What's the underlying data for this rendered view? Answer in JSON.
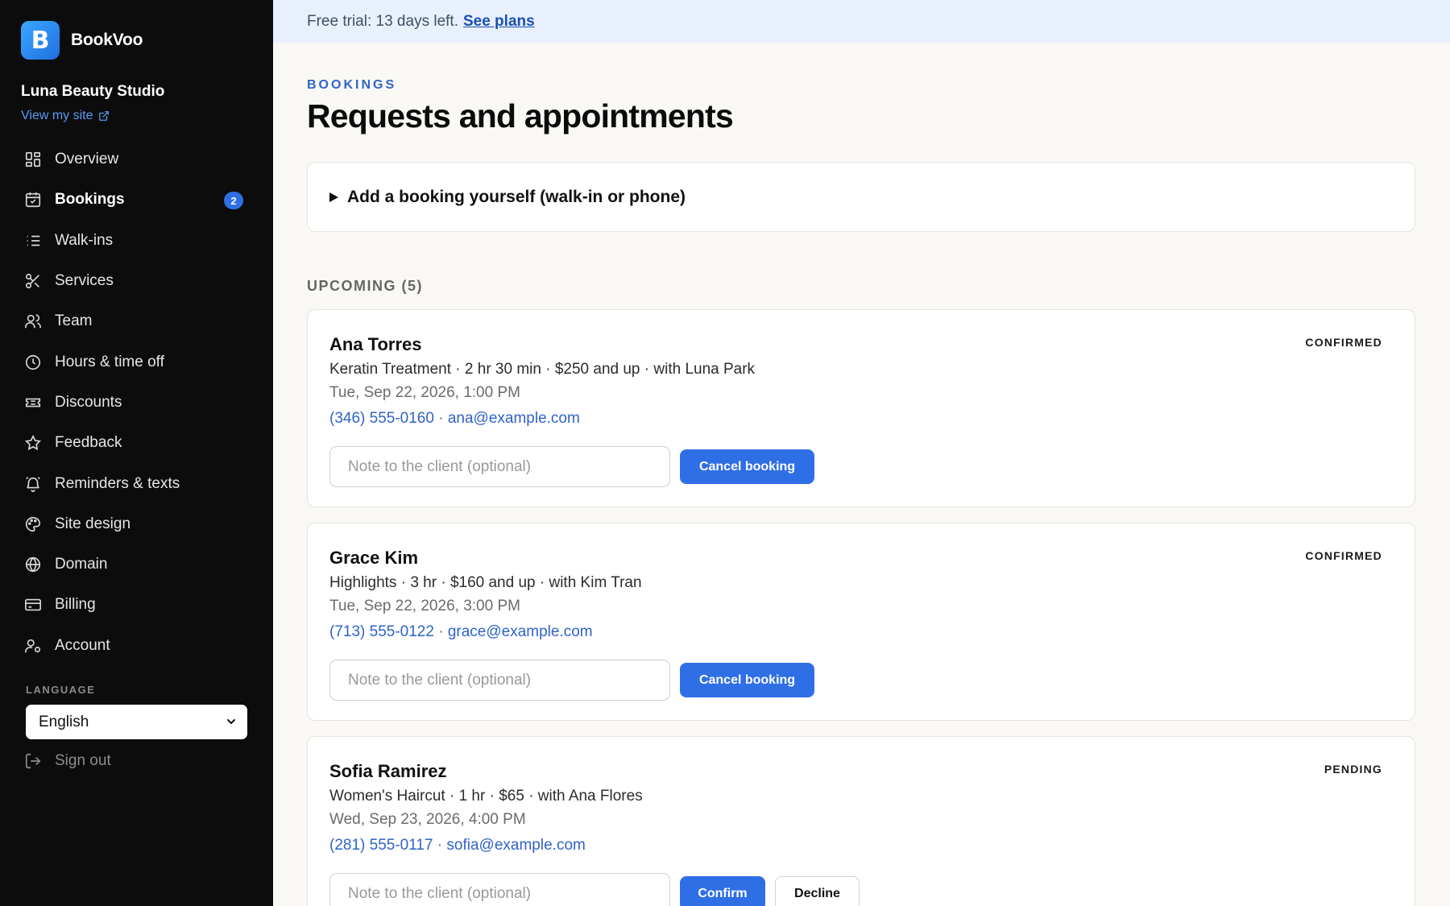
{
  "app": {
    "brand_name": "BookVoo",
    "logo_letter": "B",
    "studio_name": "Luna Beauty Studio",
    "view_site_label": "View my site"
  },
  "sidebar": {
    "items": [
      {
        "label": "Overview",
        "icon": "grid-icon"
      },
      {
        "label": "Bookings",
        "icon": "calendar-icon",
        "badge": "2",
        "active": true
      },
      {
        "label": "Walk-ins",
        "icon": "list-icon"
      },
      {
        "label": "Services",
        "icon": "scissors-icon"
      },
      {
        "label": "Team",
        "icon": "users-icon"
      },
      {
        "label": "Hours & time off",
        "icon": "clock-icon"
      },
      {
        "label": "Discounts",
        "icon": "ticket-icon"
      },
      {
        "label": "Feedback",
        "icon": "star-icon"
      },
      {
        "label": "Reminders & texts",
        "icon": "bell-icon"
      },
      {
        "label": "Site design",
        "icon": "palette-icon"
      },
      {
        "label": "Domain",
        "icon": "globe-icon"
      },
      {
        "label": "Billing",
        "icon": "credit-card-icon"
      },
      {
        "label": "Account",
        "icon": "user-gear-icon"
      }
    ],
    "language_label": "LANGUAGE",
    "language_value": "English",
    "signout_label": "Sign out"
  },
  "banner": {
    "text": "Free trial: 13 days left.",
    "link": "See plans"
  },
  "page": {
    "eyebrow": "BOOKINGS",
    "title": "Requests and appointments",
    "add_booking_label": "Add a booking yourself (walk-in or phone)",
    "upcoming_label": "UPCOMING (5)"
  },
  "bookings": [
    {
      "name": "Ana Torres",
      "status": "CONFIRMED",
      "details": "Keratin Treatment · 2 hr 30 min · $250 and up · with Luna Park",
      "datetime": "Tue, Sep 22, 2026, 1:00 PM",
      "phone": "(346) 555-0160",
      "email": "ana@example.com",
      "note_placeholder": "Note to the client (optional)",
      "primary_action": "Cancel booking"
    },
    {
      "name": "Grace Kim",
      "status": "CONFIRMED",
      "details": "Highlights · 3 hr · $160 and up · with Kim Tran",
      "datetime": "Tue, Sep 22, 2026, 3:00 PM",
      "phone": "(713) 555-0122",
      "email": "grace@example.com",
      "note_placeholder": "Note to the client (optional)",
      "primary_action": "Cancel booking"
    },
    {
      "name": "Sofia Ramirez",
      "status": "PENDING",
      "details": "Women's Haircut · 1 hr · $65 · with Ana Flores",
      "datetime": "Wed, Sep 23, 2026, 4:00 PM",
      "phone": "(281) 555-0117",
      "email": "sofia@example.com",
      "note_placeholder": "Note to the client (optional)",
      "primary_action": "Confirm",
      "secondary_action": "Decline"
    }
  ],
  "colors": {
    "sidebar_bg": "#0c0c0c",
    "accent": "#2f6fe6",
    "banner_bg": "#e8f0fc",
    "page_bg": "#faf8f4"
  }
}
